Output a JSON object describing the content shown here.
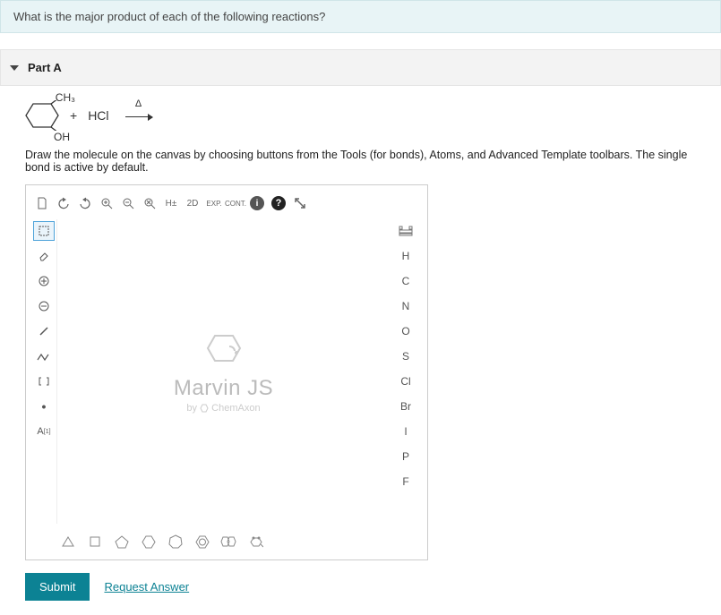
{
  "question": {
    "prompt": "What is the major product of each of the following reactions?"
  },
  "part": {
    "label": "Part A"
  },
  "reaction": {
    "substituent_top": "CH₃",
    "substituent_bottom": "OH",
    "plus": "+",
    "reagent": "HCl",
    "arrow_top": "Δ"
  },
  "instruction": "Draw the molecule on the canvas by choosing buttons from the Tools (for bonds), Atoms, and Advanced Template toolbars. The single bond is active by default.",
  "top_toolbar": {
    "h_toggle": "H±",
    "view_2d": "2D",
    "expr": "EXP.",
    "cont": "CONT."
  },
  "left_tools": {
    "map_label": "A"
  },
  "atoms": {
    "h": "H",
    "c": "C",
    "n": "N",
    "o": "O",
    "s": "S",
    "cl": "Cl",
    "br": "Br",
    "i": "I",
    "p": "P",
    "f": "F"
  },
  "marvin": {
    "title": "Marvin JS",
    "by": "by",
    "vendor": "ChemAxon"
  },
  "actions": {
    "submit": "Submit",
    "request": "Request Answer"
  }
}
